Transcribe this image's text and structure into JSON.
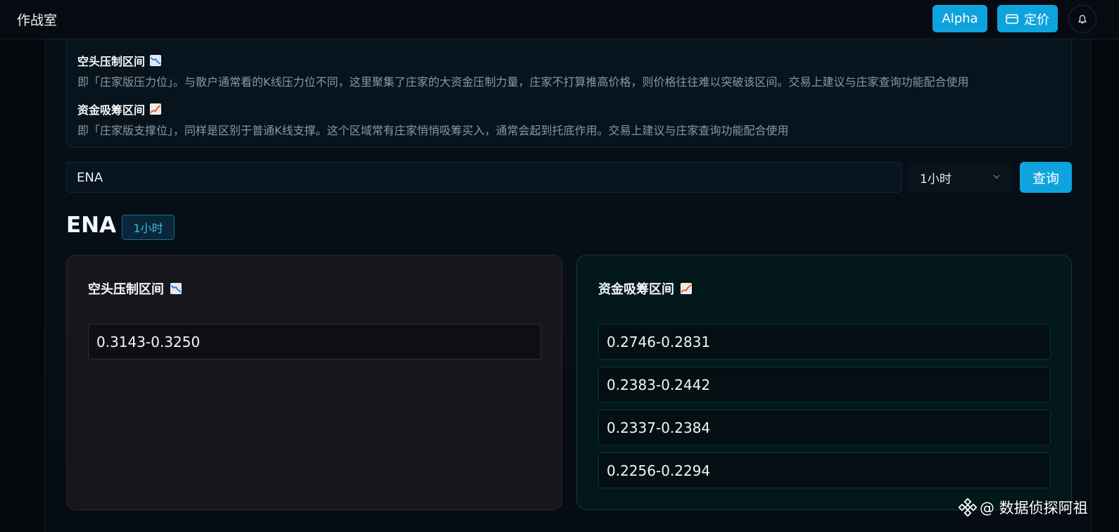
{
  "header": {
    "app_title": "作战室",
    "alpha_label": "Alpha",
    "pricing_label": "定价"
  },
  "info": {
    "bear_title": "空头压制区间",
    "bear_desc": "即「庄家版压力位」。与散户通常看的K线压力位不同，这里聚集了庄家的大资金压制力量，庄家不打算推高价格，则价格往往难以突破该区间。交易上建议与庄家查询功能配合使用",
    "bull_title": "资金吸筹区间",
    "bull_desc": "即「庄家版支撑位」，同样是区别于普通K线支撑。这个区域常有庄家悄悄吸筹买入，通常会起到托底作用。交易上建议与庄家查询功能配合使用"
  },
  "search": {
    "value": "ENA",
    "timeframe": "1小时",
    "query_label": "查询"
  },
  "result": {
    "symbol": "ENA",
    "timeframe_badge": "1小时"
  },
  "bear_panel": {
    "title": "空头压制区间",
    "ranges": [
      "0.3143-0.3250"
    ]
  },
  "bull_panel": {
    "title": "资金吸筹区间",
    "ranges": [
      "0.2746-0.2831",
      "0.2383-0.2442",
      "0.2337-0.2384",
      "0.2256-0.2294"
    ]
  },
  "watermark": "@ 数据侦探阿祖",
  "colors": {
    "accent": "#0fa3dd",
    "bear_border": "#3a2328",
    "bull_border": "#0f3a37"
  },
  "icons": {
    "bear": "chart-decreasing-icon",
    "bull": "chart-increasing-icon",
    "pricing": "card-icon",
    "notifications": "bell-icon",
    "select": "chevron-down-icon",
    "watermark": "binance-logo-icon"
  }
}
